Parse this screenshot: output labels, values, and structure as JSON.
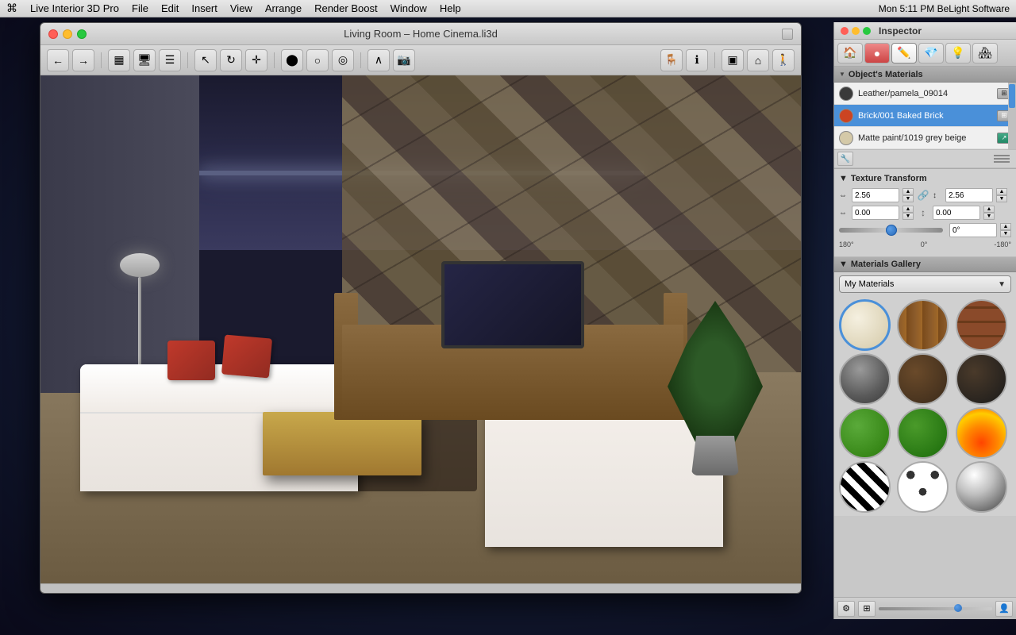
{
  "menubar": {
    "apple": "⌘",
    "appname": "Live Interior 3D Pro",
    "menus": [
      "File",
      "Edit",
      "Insert",
      "View",
      "Arrange",
      "Render Boost",
      "Window",
      "Help"
    ],
    "right": "Mon 5:11 PM   BeLight Software"
  },
  "window": {
    "title": "Living Room – Home Cinema.li3d",
    "traffic_lights": [
      "close",
      "minimize",
      "maximize"
    ]
  },
  "inspector": {
    "title": "Inspector",
    "tabs": [
      "🏠",
      "●",
      "✏️",
      "💎",
      "💡",
      "🏠"
    ],
    "objects_materials_label": "Object's Materials",
    "materials": [
      {
        "id": "leather",
        "name": "Leather/pamela_09014",
        "color": "#3a3a3a",
        "selected": false
      },
      {
        "id": "brick",
        "name": "Brick/001 Baked Brick",
        "color": "#cc4422",
        "selected": true
      },
      {
        "id": "matte",
        "name": "Matte paint/1019 grey beige",
        "color": "#d4c9a8",
        "selected": false
      }
    ],
    "texture_transform": {
      "label": "Texture Transform",
      "width_val": "2.56",
      "height_val": "2.56",
      "offset_x": "0.00",
      "offset_y": "0.00",
      "rotation": "0°",
      "angle_min": "180°",
      "angle_mid": "0°",
      "angle_max": "-180°"
    },
    "gallery": {
      "label": "Materials Gallery",
      "dropdown_selected": "My Materials",
      "swatches": [
        {
          "id": "cream",
          "class": "sw-cream",
          "selected": true
        },
        {
          "id": "wood1",
          "class": "sw-wood1",
          "selected": false
        },
        {
          "id": "brick",
          "class": "sw-brick",
          "selected": false
        },
        {
          "id": "metal",
          "class": "sw-metal",
          "selected": false
        },
        {
          "id": "leather",
          "class": "sw-leather",
          "selected": false
        },
        {
          "id": "dark",
          "class": "sw-dark",
          "selected": false
        },
        {
          "id": "green1",
          "class": "sw-green1",
          "selected": false
        },
        {
          "id": "green2",
          "class": "sw-green2",
          "selected": false
        },
        {
          "id": "fire",
          "class": "sw-fire",
          "selected": false
        },
        {
          "id": "zebra",
          "class": "sw-zebra",
          "selected": false
        },
        {
          "id": "spots",
          "class": "sw-spots",
          "selected": false
        },
        {
          "id": "chrome",
          "class": "sw-chrome",
          "selected": false
        }
      ]
    }
  }
}
